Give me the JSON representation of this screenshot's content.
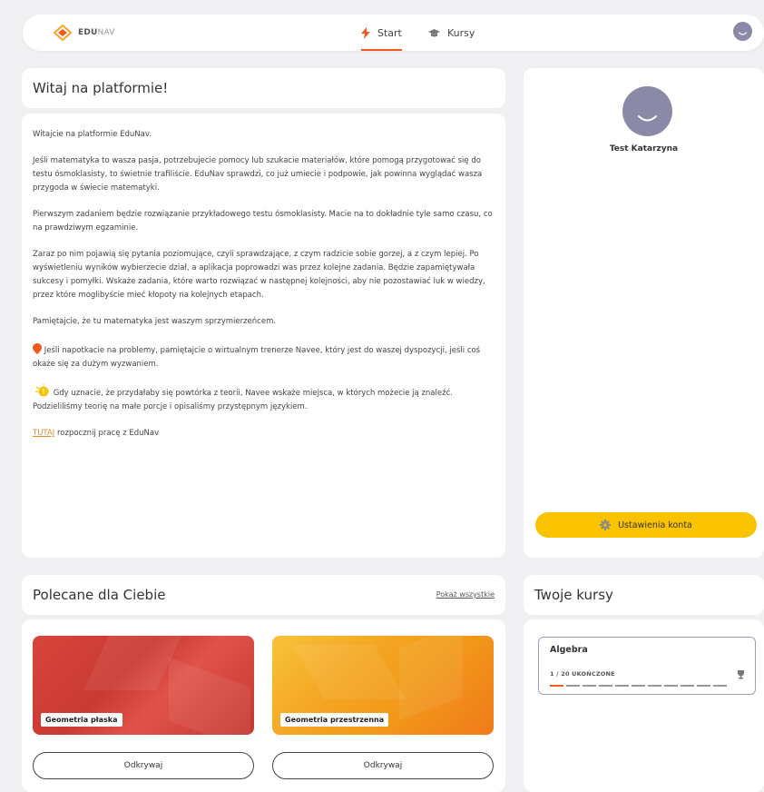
{
  "nav": {
    "logo_bold": "EDU",
    "logo_light": "NAV",
    "tabs": [
      {
        "label": "Start",
        "icon": "lightning-icon",
        "active": true
      },
      {
        "label": "Kursy",
        "icon": "graduation-cap-icon",
        "active": false
      }
    ]
  },
  "welcome": {
    "title": "Witaj na platformie!",
    "p1": "Witajcie na platformie EduNav.",
    "p2": "Jeśli matematyka to wasza pasja, potrzebujecie pomocy lub szukacie materiałów, które pomogą przygotować się do testu ósmoklasisty, to świetnie trafiliście. EduNav sprawdzi, co już umiecie i podpowie, jak powinna wyglądać wasza przygoda w świecie matematyki.",
    "p3": "Pierwszym zadaniem będzie rozwiązanie przykładowego testu ósmoklasisty.  Macie na to dokładnie tyle samo czasu, co na prawdziwym egzaminie.",
    "p4": "Zaraz po nim pojawią się pytania poziomujące, czyli sprawdzające, z czym radzicie sobie gorzej, a z czym lepiej. Po wyświetleniu wyników wybierzecie dział, a aplikacja poprowadzi was przez kolejne zadania. Będzie zapamiętywała sukcesy i pomyłki. Wskaże zadania, które warto rozwiązać w następnej kolejności, aby nie pozostawiać luk w wiedzy, przez które moglibyście mieć kłopoty na kolejnych etapach.",
    "p5": "Pamiętajcie, że tu matematyka jest waszym sprzymierzeńcem.",
    "p6": "Jeśli napotkacie na problemy, pamiętajcie o wirtualnym trenerze Navee, który jest do waszej dyspozycji, jeśli coś okaże się za dużym wyzwaniem.",
    "p7": "Gdy uznacie, że przydałaby się powtórka z teorii, Navee wskaże miejsca, w których możecie ją znaleźć. Podzieliliśmy teorię na małe porcje i opisaliśmy przystępnym językiem.",
    "link_text": "TUTAJ",
    "link_rest": " rozpocznij pracę z EduNav"
  },
  "profile": {
    "name": "Test Katarzyna",
    "settings_label": "Ustawienia konta"
  },
  "recommended": {
    "title": "Polecane dla Ciebie",
    "see_all": "Pokaż wszystkie",
    "tiles": [
      {
        "label": "Geometria płaska",
        "button": "Odkrywaj",
        "color": "#d8453c"
      },
      {
        "label": "Geometria przestrzenna",
        "button": "Odkrywaj",
        "color": "#f5a623"
      }
    ]
  },
  "my_courses": {
    "title": "Twoje kursy",
    "courses": [
      {
        "name": "Algebra",
        "progress_text": "1 / 20 UKOŃCZONE",
        "completed": 1,
        "total": 20
      }
    ]
  },
  "colors": {
    "accent": "#f05a1c",
    "yellow": "#f9c300",
    "avatar": "#8a8aa8"
  }
}
